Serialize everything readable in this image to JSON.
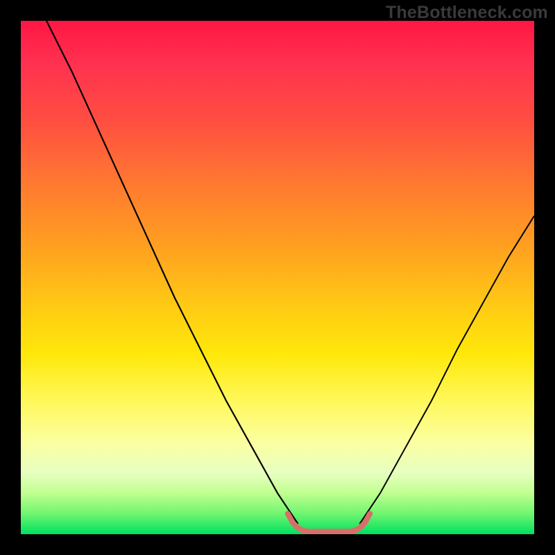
{
  "watermark": "TheBottleneck.com",
  "chart_data": {
    "type": "line",
    "title": "",
    "xlabel": "",
    "ylabel": "",
    "xlim": [
      0,
      100
    ],
    "ylim": [
      0,
      100
    ],
    "background_gradient_stops": [
      {
        "pos": 0,
        "color": "#ff1744"
      },
      {
        "pos": 20,
        "color": "#ff5040"
      },
      {
        "pos": 44,
        "color": "#ffa020"
      },
      {
        "pos": 65,
        "color": "#ffe80a"
      },
      {
        "pos": 82,
        "color": "#fbffa0"
      },
      {
        "pos": 92,
        "color": "#c0ff90"
      },
      {
        "pos": 100,
        "color": "#00e060"
      }
    ],
    "series": [
      {
        "name": "left-curve",
        "stroke": "#000000",
        "stroke_width": 2,
        "x": [
          5,
          10,
          15,
          20,
          25,
          30,
          35,
          40,
          45,
          50,
          54
        ],
        "y": [
          100,
          90,
          79,
          68,
          57,
          46,
          36,
          26,
          17,
          8,
          2
        ]
      },
      {
        "name": "right-curve",
        "stroke": "#000000",
        "stroke_width": 2,
        "x": [
          66,
          70,
          75,
          80,
          85,
          90,
          95,
          100
        ],
        "y": [
          2,
          8,
          17,
          26,
          36,
          45,
          54,
          62
        ]
      },
      {
        "name": "bottom-bracket",
        "stroke": "#d6706a",
        "stroke_width": 6,
        "x": [
          52,
          53,
          54,
          55,
          56,
          58,
          60,
          62,
          64,
          65,
          66,
          67,
          68
        ],
        "y": [
          4,
          2.2,
          1.2,
          0.7,
          0.5,
          0.5,
          0.5,
          0.5,
          0.5,
          0.7,
          1.2,
          2.2,
          4
        ]
      }
    ]
  }
}
